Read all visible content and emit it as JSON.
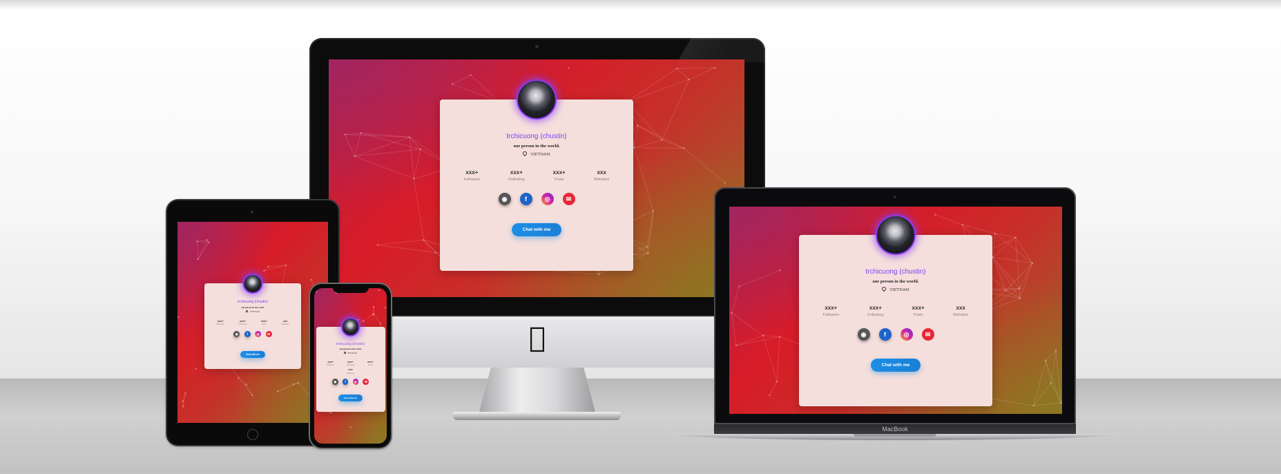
{
  "profile": {
    "name": "trchicuong (chustin)",
    "bio": "one person in the world.",
    "location": "VIETNAM",
    "stats": [
      {
        "value": "xxx+",
        "label": "Followers"
      },
      {
        "value": "xxx+",
        "label": "Following"
      },
      {
        "value": "xxx+",
        "label": "Posts"
      },
      {
        "value": "xxx",
        "label": "Websites"
      }
    ],
    "socials": [
      {
        "icon": "github-icon",
        "glyph": "◉",
        "color": "#555555"
      },
      {
        "icon": "facebook-icon",
        "glyph": "f",
        "color": "#1e63c9"
      },
      {
        "icon": "instagram-icon",
        "glyph": "◎",
        "color": "#d6249f"
      },
      {
        "icon": "mail-icon",
        "glyph": "✉",
        "color": "#e8273a"
      }
    ],
    "chat_label": "Chat with me",
    "accent_color": "#7b3ff0",
    "button_color": "#1d8fe6"
  },
  "laptop": {
    "brand_label": "MacBook"
  }
}
